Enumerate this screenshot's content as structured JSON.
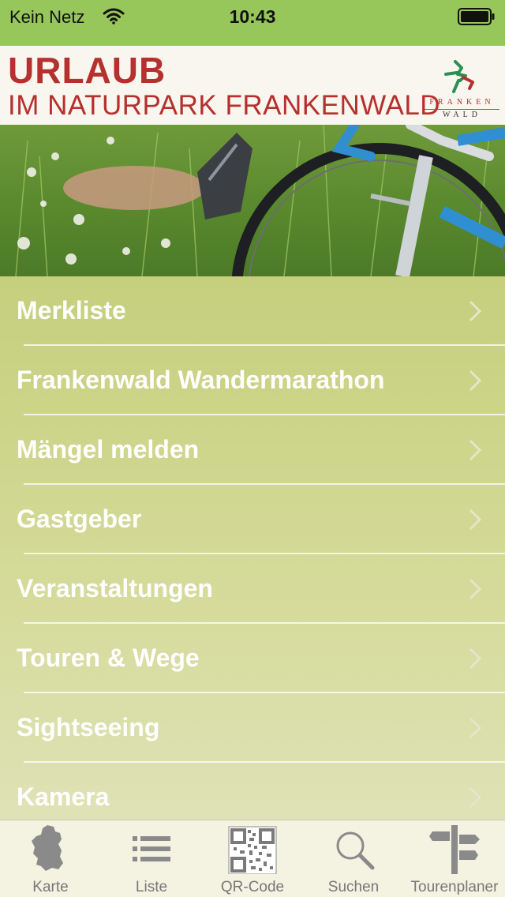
{
  "status_bar": {
    "carrier": "Kein Netz",
    "time": "10:43",
    "wifi_icon": "wifi-icon",
    "battery_icon": "battery-icon"
  },
  "banner": {
    "title": "URLAUB",
    "subtitle": "IM NATURPARK FRANKENWALD",
    "logo_text_top": "FRANKEN",
    "logo_text_bottom": "WALD",
    "title_color": "#b5302f"
  },
  "menu": {
    "items": [
      {
        "label": "Merkliste"
      },
      {
        "label": "Frankenwald Wandermarathon"
      },
      {
        "label": "Mängel melden"
      },
      {
        "label": "Gastgeber"
      },
      {
        "label": "Veranstaltungen"
      },
      {
        "label": "Touren & Wege"
      },
      {
        "label": "Sightseeing"
      },
      {
        "label": "Kamera"
      }
    ],
    "chevron_icon": "chevron-right-icon"
  },
  "tabbar": {
    "tabs": [
      {
        "label": "Karte",
        "icon": "germany-map-icon"
      },
      {
        "label": "Liste",
        "icon": "list-icon"
      },
      {
        "label": "QR-Code",
        "icon": "qr-code-icon"
      },
      {
        "label": "Suchen",
        "icon": "search-icon"
      },
      {
        "label": "Tourenplaner",
        "icon": "signpost-icon"
      }
    ]
  },
  "colors": {
    "status_bar": "#97c65a",
    "menu_top": "#c5cf7c",
    "menu_bottom": "#dfe2b6",
    "tabbar_bg": "#f4f2e1"
  }
}
